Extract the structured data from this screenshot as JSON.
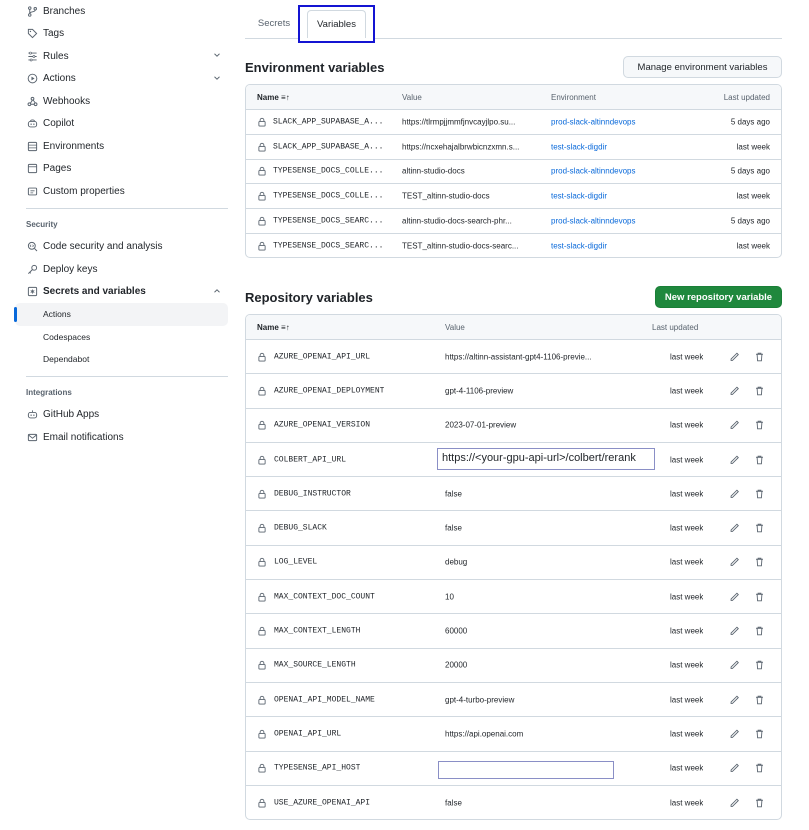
{
  "sidebar": {
    "items": [
      {
        "label": "Branches",
        "icon": "branch-icon"
      },
      {
        "label": "Tags",
        "icon": "tag-icon"
      },
      {
        "label": "Rules",
        "icon": "rules-icon",
        "chevron": "down"
      },
      {
        "label": "Actions",
        "icon": "play-icon",
        "chevron": "down"
      },
      {
        "label": "Webhooks",
        "icon": "webhook-icon"
      },
      {
        "label": "Copilot",
        "icon": "copilot-icon"
      },
      {
        "label": "Environments",
        "icon": "server-icon"
      },
      {
        "label": "Pages",
        "icon": "browser-icon"
      },
      {
        "label": "Custom properties",
        "icon": "note-icon"
      }
    ],
    "security_heading": "Security",
    "security_items": [
      {
        "label": "Code security and analysis",
        "icon": "codescan-icon"
      },
      {
        "label": "Deploy keys",
        "icon": "key-icon"
      },
      {
        "label": "Secrets and variables",
        "icon": "asterisk-icon",
        "chevron": "up"
      }
    ],
    "secrets_sub": [
      "Actions",
      "Codespaces",
      "Dependabot"
    ],
    "integrations_heading": "Integrations",
    "integration_items": [
      {
        "label": "GitHub Apps",
        "icon": "apps-icon"
      },
      {
        "label": "Email notifications",
        "icon": "mail-icon"
      }
    ]
  },
  "tabs": {
    "secrets": "Secrets",
    "variables": "Variables"
  },
  "env": {
    "title": "Environment variables",
    "manage_button": "Manage environment variables",
    "columns": {
      "name": "Name",
      "value": "Value",
      "environment": "Environment",
      "updated": "Last updated"
    },
    "rows": [
      {
        "name": "SLACK_APP_SUPABASE_A...",
        "value": "https://tlrmpjjmmfjnvcayjlpo.su...",
        "environment": "prod-slack-altinndevops",
        "updated": "5 days ago"
      },
      {
        "name": "SLACK_APP_SUPABASE_A...",
        "value": "https://ncxehajalbrwbicnzxmn.s...",
        "environment": "test-slack-digdir",
        "updated": "last week"
      },
      {
        "name": "TYPESENSE_DOCS_COLLE...",
        "value": "altinn-studio-docs",
        "environment": "prod-slack-altinndevops",
        "updated": "5 days ago"
      },
      {
        "name": "TYPESENSE_DOCS_COLLE...",
        "value": "TEST_altinn-studio-docs",
        "environment": "test-slack-digdir",
        "updated": "last week"
      },
      {
        "name": "TYPESENSE_DOCS_SEARC...",
        "value": "altinn-studio-docs-search-phr...",
        "environment": "prod-slack-altinndevops",
        "updated": "5 days ago"
      },
      {
        "name": "TYPESENSE_DOCS_SEARC...",
        "value": "TEST_altinn-studio-docs-searc...",
        "environment": "test-slack-digdir",
        "updated": "last week"
      }
    ]
  },
  "repo": {
    "title": "Repository variables",
    "new_button": "New repository variable",
    "columns": {
      "name": "Name",
      "value": "Value",
      "updated": "Last updated"
    },
    "rows": [
      {
        "name": "AZURE_OPENAI_API_URL",
        "value": "https://altinn-assistant-gpt4-1106-previe...",
        "updated": "last week"
      },
      {
        "name": "AZURE_OPENAI_DEPLOYMENT",
        "value": "gpt-4-1106-preview",
        "updated": "last week"
      },
      {
        "name": "AZURE_OPENAI_VERSION",
        "value": "2023-07-01-preview",
        "updated": "last week"
      },
      {
        "name": "COLBERT_API_URL",
        "value": "https://<your-gpu-api-url>/colbert/rerank",
        "updated": "last week"
      },
      {
        "name": "DEBUG_INSTRUCTOR",
        "value": "false",
        "updated": "last week"
      },
      {
        "name": "DEBUG_SLACK",
        "value": "false",
        "updated": "last week"
      },
      {
        "name": "LOG_LEVEL",
        "value": "debug",
        "updated": "last week"
      },
      {
        "name": "MAX_CONTEXT_DOC_COUNT",
        "value": "10",
        "updated": "last week"
      },
      {
        "name": "MAX_CONTEXT_LENGTH",
        "value": "60000",
        "updated": "last week"
      },
      {
        "name": "MAX_SOURCE_LENGTH",
        "value": "20000",
        "updated": "last week"
      },
      {
        "name": "OPENAI_API_MODEL_NAME",
        "value": "gpt-4-turbo-preview",
        "updated": "last week"
      },
      {
        "name": "OPENAI_API_URL",
        "value": "https://api.openai.com",
        "updated": "last week"
      },
      {
        "name": "TYPESENSE_API_HOST",
        "value": "",
        "updated": "last week"
      },
      {
        "name": "USE_AZURE_OPENAI_API",
        "value": "false",
        "updated": "last week"
      }
    ]
  }
}
